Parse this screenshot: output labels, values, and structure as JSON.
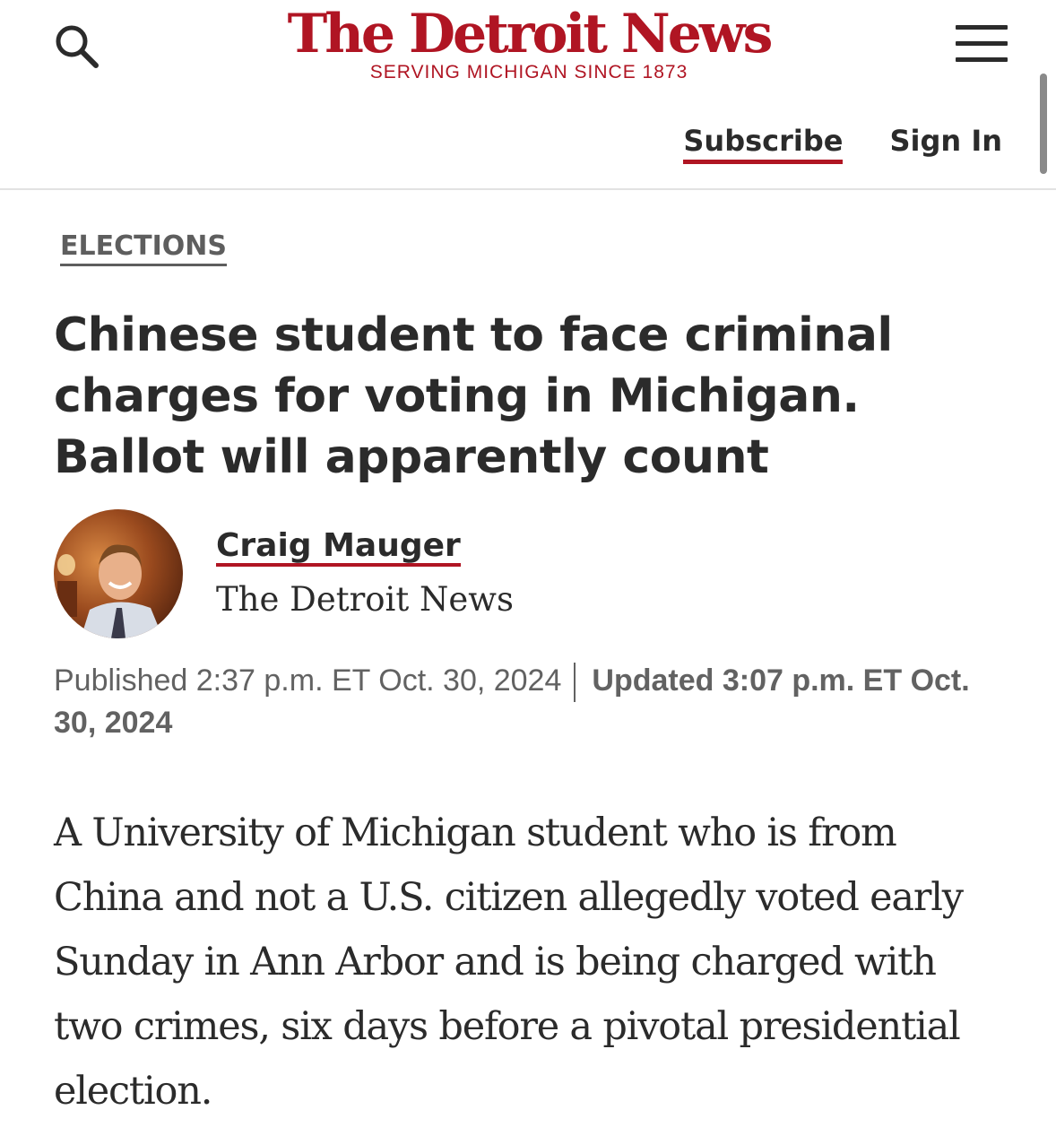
{
  "header": {
    "brand_name": "The Detroit News",
    "brand_tagline": "SERVING MICHIGAN SINCE 1873",
    "subscribe_label": "Subscribe",
    "signin_label": "Sign In",
    "icons": [
      "search-icon",
      "hamburger-menu-icon"
    ]
  },
  "article": {
    "section": "ELECTIONS",
    "headline": "Chinese student to face criminal charges for voting in Michigan. Ballot will apparently count",
    "author": {
      "name": "Craig Mauger",
      "organization": "The Detroit News"
    },
    "published": "Published 2:37 p.m. ET Oct. 30, 2024",
    "updated": "Updated 3:07 p.m. ET Oct. 30, 2024",
    "body": "A University of Michigan student who is from China and not a U.S. citizen allegedly voted early Sunday in Ann Arbor and is being charged with two crimes, six days before a pivotal presidential election."
  },
  "colors": {
    "brand": "#b01523",
    "text": "#2b2b2b",
    "muted": "#626262"
  }
}
